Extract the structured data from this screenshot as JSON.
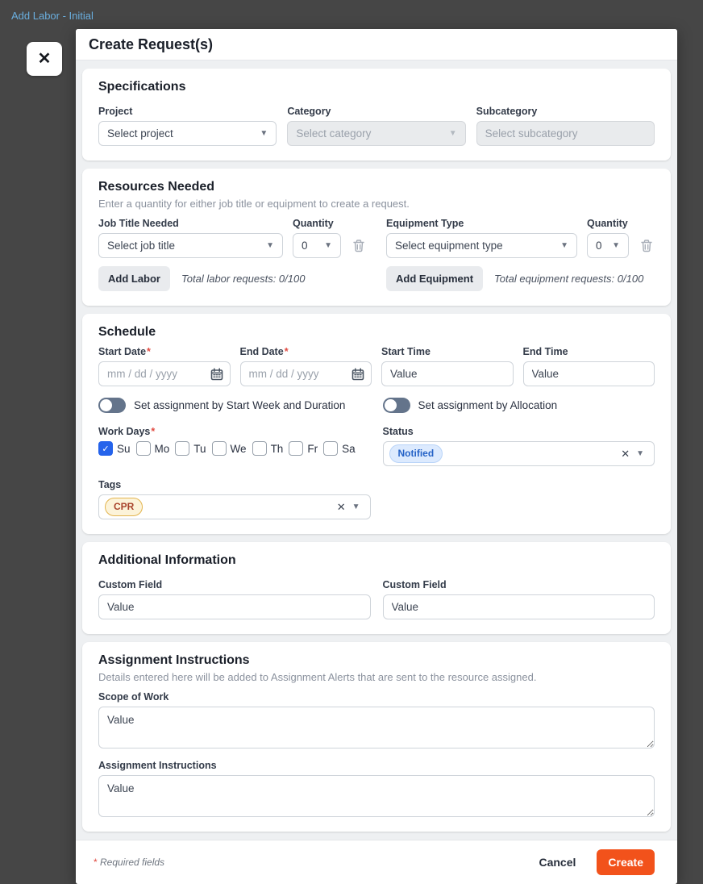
{
  "backdrop": {
    "link_label": "Add Labor - Initial"
  },
  "modal": {
    "title": "Create Request(s)"
  },
  "icons": {
    "close": "✕",
    "caret": "▼",
    "clear": "✕",
    "check": "✓"
  },
  "specifications": {
    "heading": "Specifications",
    "project": {
      "label": "Project",
      "placeholder": "Select project"
    },
    "category": {
      "label": "Category",
      "placeholder": "Select category"
    },
    "subcategory": {
      "label": "Subcategory",
      "placeholder": "Select subcategory"
    }
  },
  "resources": {
    "heading": "Resources Needed",
    "description": "Enter a quantity for either job title or equipment to create a request.",
    "labor": {
      "job_title_label": "Job Title Needed",
      "job_title_placeholder": "Select job title",
      "quantity_label": "Quantity",
      "quantity_value": "0",
      "add_button": "Add Labor",
      "total_text": "Total labor requests: 0/100"
    },
    "equipment": {
      "type_label": "Equipment Type",
      "type_placeholder": "Select equipment type",
      "quantity_label": "Quantity",
      "quantity_value": "0",
      "add_button": "Add Equipment",
      "total_text": "Total equipment requests: 0/100"
    }
  },
  "schedule": {
    "heading": "Schedule",
    "start_date": {
      "label": "Start Date",
      "required": "*",
      "placeholder": "mm / dd / yyyy"
    },
    "end_date": {
      "label": "End Date",
      "required": "*",
      "placeholder": "mm / dd / yyyy"
    },
    "start_time": {
      "label": "Start Time",
      "value": "Value"
    },
    "end_time": {
      "label": "End Time",
      "value": "Value"
    },
    "toggle_week": {
      "label": "Set assignment by Start Week and Duration",
      "on": false
    },
    "toggle_allocation": {
      "label": "Set assignment by Allocation",
      "on": false
    },
    "work_days": {
      "label": "Work Days",
      "required": "*",
      "items": [
        {
          "label": "Su",
          "checked": true
        },
        {
          "label": "Mo",
          "checked": false
        },
        {
          "label": "Tu",
          "checked": false
        },
        {
          "label": "We",
          "checked": false
        },
        {
          "label": "Th",
          "checked": false
        },
        {
          "label": "Fr",
          "checked": false
        },
        {
          "label": "Sa",
          "checked": false
        }
      ]
    },
    "status": {
      "label": "Status",
      "chip": "Notified"
    },
    "tags": {
      "label": "Tags",
      "chip": "CPR"
    }
  },
  "additional": {
    "heading": "Additional Information",
    "field1": {
      "label": "Custom Field",
      "value": "Value"
    },
    "field2": {
      "label": "Custom Field",
      "value": "Value"
    }
  },
  "instructions": {
    "heading": "Assignment Instructions",
    "description": "Details entered here will be added to Assignment Alerts that are sent to the resource assigned.",
    "scope": {
      "label": "Scope of Work",
      "value": "Value"
    },
    "assignment": {
      "label": "Assignment Instructions",
      "value": "Value"
    }
  },
  "footer": {
    "required_star": "*",
    "required_note": " Required fields",
    "cancel_label": "Cancel",
    "create_label": "Create"
  },
  "colors": {
    "backdrop": "#464646",
    "accent_orange": "#f2521b",
    "checkbox_blue": "#2563eb",
    "status_chip_bg": "#dceafe",
    "status_chip_text": "#2563c7",
    "tag_chip_bg": "#fcf3d9",
    "tag_chip_border": "#e3b54f",
    "tag_chip_text": "#a8432c",
    "toggle_track": "#64748b"
  }
}
